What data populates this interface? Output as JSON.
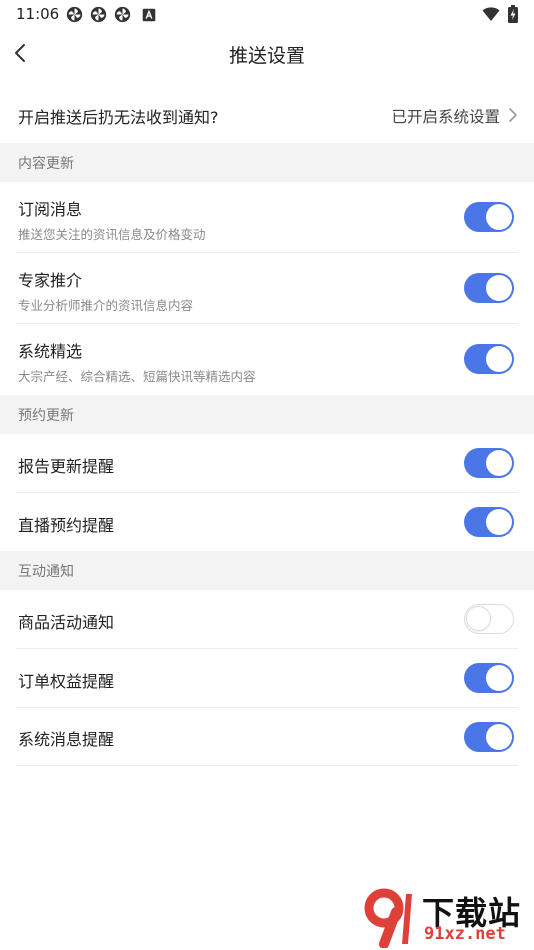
{
  "status_bar": {
    "time": "11:06",
    "left_icons": [
      "pinwheel-icon",
      "pinwheel-icon",
      "pinwheel-icon",
      "a-box-icon"
    ],
    "right_icons": [
      "wifi-icon",
      "battery-charging-icon"
    ]
  },
  "nav": {
    "title": "推送设置",
    "back_icon": "back-chevron-icon"
  },
  "notice": {
    "label": "开启推送后扔无法收到通知?",
    "value": "已开启系统设置"
  },
  "sections": [
    {
      "header": "内容更新",
      "rows": [
        {
          "title": "订阅消息",
          "subtitle": "推送您关注的资讯信息及价格变动",
          "enabled": true
        },
        {
          "title": "专家推介",
          "subtitle": "专业分析师推介的资讯信息内容",
          "enabled": true
        },
        {
          "title": "系统精选",
          "subtitle": "大宗产经、综合精选、短篇快讯等精选内容",
          "enabled": true
        }
      ]
    },
    {
      "header": "预约更新",
      "rows": [
        {
          "title": "报告更新提醒",
          "enabled": true
        },
        {
          "title": "直播预约提醒",
          "enabled": true
        }
      ]
    },
    {
      "header": "互动通知",
      "rows": [
        {
          "title": "商品活动通知",
          "enabled": false
        },
        {
          "title": "订单权益提醒",
          "enabled": true
        },
        {
          "title": "系统消息提醒",
          "enabled": true
        }
      ]
    }
  ],
  "watermark": {
    "name": "下载站",
    "url": "91xz.net"
  },
  "colors": {
    "accent": "#4a76e8",
    "section_bg": "#f3f3f3",
    "watermark_red": "#e0403a"
  }
}
